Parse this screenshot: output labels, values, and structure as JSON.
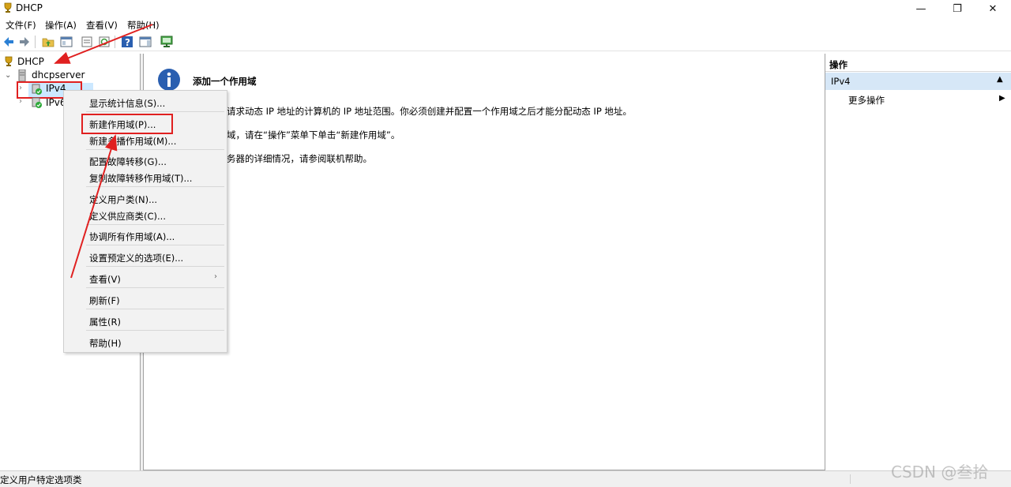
{
  "window": {
    "title": "DHCP",
    "minimize": "—",
    "restore": "❐",
    "close": "✕"
  },
  "menubar": [
    "文件(F)",
    "操作(A)",
    "查看(V)",
    "帮助(H)"
  ],
  "tree": {
    "root": "DHCP",
    "server": "dhcpserver",
    "ipv4": "IPv4",
    "ipv6": "IPv6"
  },
  "content": {
    "heading": "添加一个作用域",
    "lines": [
      "请求动态 IP 地址的计算机的 IP 地址范围。你必须创建并配置一个作用域之后才能分配动态 IP 地址。",
      "域，请在“操作”菜单下单击“新建作用域”。",
      "务器的详细情况，请参阅联机帮助。"
    ]
  },
  "actions": {
    "header": "操作",
    "section": "IPv4",
    "more": "更多操作"
  },
  "context_menu": [
    "显示统计信息(S)...",
    "新建作用域(P)...",
    "新建多播作用域(M)...",
    "配置故障转移(G)...",
    "复制故障转移作用域(T)...",
    "定义用户类(N)...",
    "定义供应商类(C)...",
    "协调所有作用域(A)...",
    "设置预定义的选项(E)...",
    "查看(V)",
    "刷新(F)",
    "属性(R)",
    "帮助(H)"
  ],
  "status": "定义用户特定选项类",
  "watermark": "CSDN @叁拾",
  "colors": {
    "accent_red": "#e02020",
    "info_blue": "#2a5fb0"
  }
}
